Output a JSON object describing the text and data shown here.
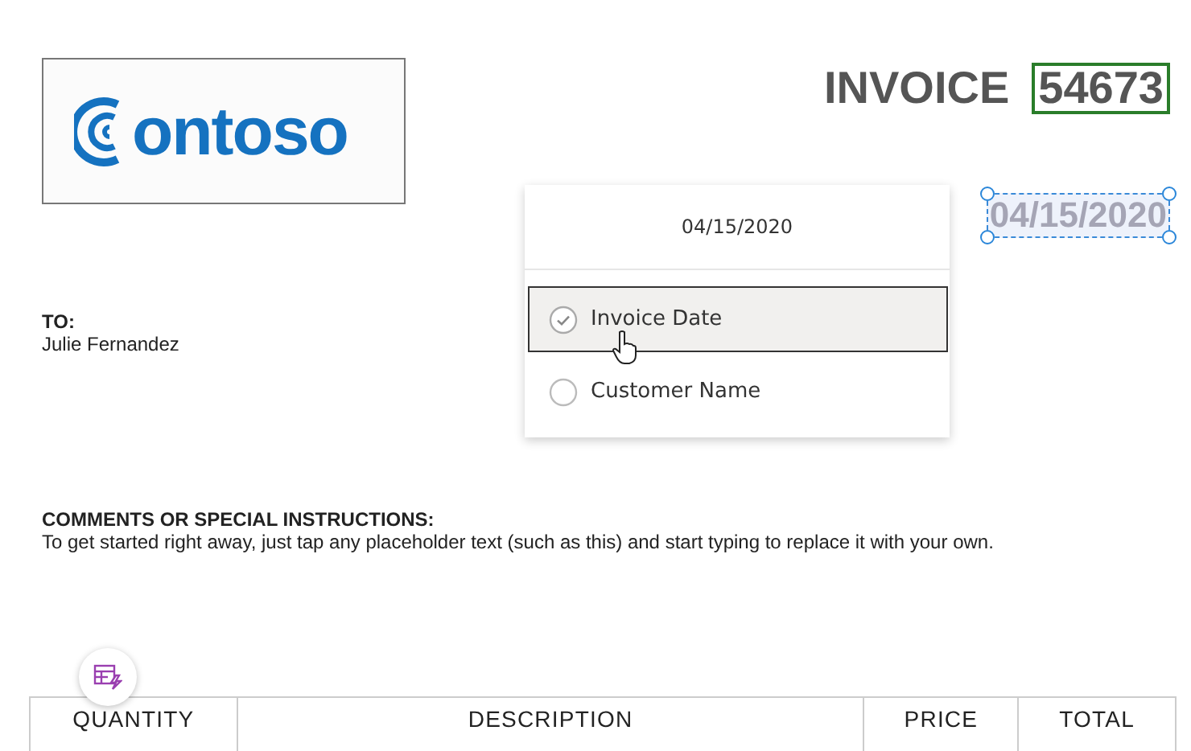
{
  "logo": {
    "text": "ontoso"
  },
  "invoice": {
    "title": "INVOICE",
    "number": "54673",
    "date": "04/15/2020"
  },
  "popup": {
    "header": "04/15/2020",
    "options": [
      {
        "label": "Invoice Date",
        "selected": true
      },
      {
        "label": "Customer Name",
        "selected": false
      }
    ]
  },
  "recipient": {
    "label": "TO:",
    "name": "Julie Fernandez"
  },
  "comments": {
    "heading": "COMMENTS OR SPECIAL INSTRUCTIONS:",
    "text": "To get started right away, just tap any placeholder text (such as this) and start typing to replace it with your own."
  },
  "table": {
    "columns": [
      "QUANTITY",
      "DESCRIPTION",
      "PRICE",
      "TOTAL"
    ]
  }
}
